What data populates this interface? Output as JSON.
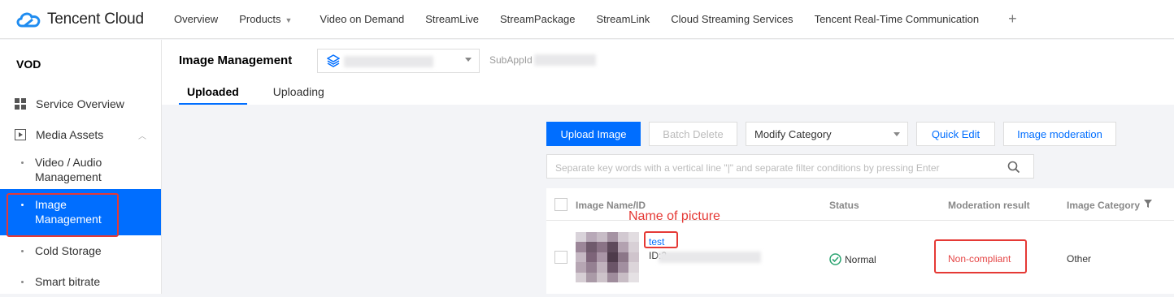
{
  "brand": {
    "name": "Tencent Cloud",
    "logo_color": "#1f8cf0"
  },
  "topnav": {
    "items": [
      "Overview",
      "Products",
      "Video on Demand",
      "StreamLive",
      "StreamPackage",
      "StreamLink",
      "Cloud Streaming Services",
      "Tencent Real-Time Communication"
    ],
    "plus": "+"
  },
  "sidebar": {
    "title": "VOD",
    "items": [
      {
        "label": "Service Overview",
        "icon": "grid-icon"
      },
      {
        "label": "Media Assets",
        "icon": "play-box-icon",
        "expanded": true
      }
    ],
    "subitems": [
      {
        "label_line1": "Video / Audio",
        "label_line2": "Management"
      },
      {
        "label_line1": "Image",
        "label_line2": "Management",
        "active": true
      },
      {
        "label_line1": "Cold Storage"
      },
      {
        "label_line1": "Smart bitrate"
      }
    ]
  },
  "header": {
    "title": "Image Management",
    "subapp_label": "SubAppId",
    "tabs": [
      {
        "label": "Uploaded",
        "active": true
      },
      {
        "label": "Uploading",
        "active": false
      }
    ]
  },
  "toolbar": {
    "upload": "Upload Image",
    "batch_delete": "Batch Delete",
    "category_select": "Modify Category",
    "quick_edit": "Quick Edit",
    "moderation": "Image moderation"
  },
  "search": {
    "placeholder": "Separate key words with a vertical line \"|\" and separate filter conditions by pressing Enter"
  },
  "table": {
    "columns": [
      "Image Name/ID",
      "Status",
      "Moderation result",
      "Image Category"
    ],
    "rows": [
      {
        "name": "test",
        "id_prefix": "ID:2",
        "status": "Normal",
        "moderation": "Non-compliant",
        "category": "Other"
      }
    ]
  },
  "annotation": {
    "text": "Name of picture"
  },
  "colors": {
    "accent": "#006eff",
    "highlight": "#e53935",
    "status_ok": "#2ba471"
  }
}
